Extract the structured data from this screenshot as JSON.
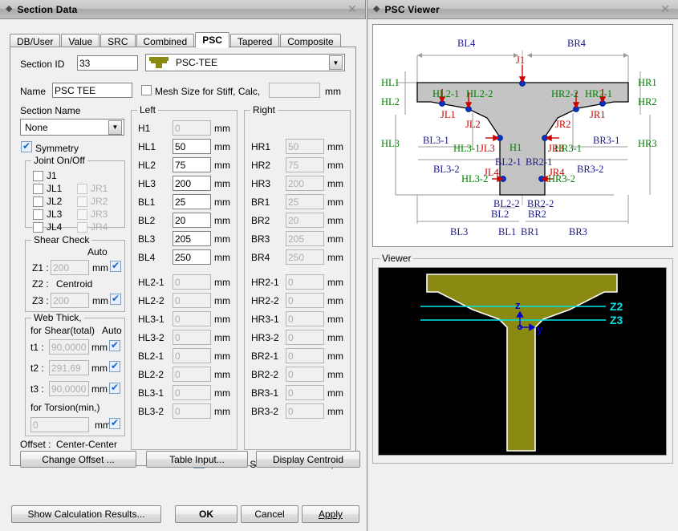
{
  "section_window": {
    "title": "Section Data",
    "close_label": "✕",
    "tabs": [
      {
        "label": "DB/User",
        "active": false
      },
      {
        "label": "Value",
        "active": false
      },
      {
        "label": "SRC",
        "active": false
      },
      {
        "label": "Combined",
        "active": false
      },
      {
        "label": "PSC",
        "active": true
      },
      {
        "label": "Tapered",
        "active": false
      },
      {
        "label": "Composite",
        "active": false
      }
    ],
    "section_id": {
      "label": "Section ID",
      "value": "33"
    },
    "section_type": {
      "value": "PSC-TEE",
      "icon": "psc-tee-icon"
    },
    "name": {
      "label": "Name",
      "value": "PSC TEE"
    },
    "mesh_size": {
      "label": "Mesh Size for Stiff, Calc,",
      "checked": false,
      "value": "",
      "unit": "mm"
    },
    "section_name": {
      "label": "Section Name",
      "value": "None"
    },
    "symmetry": {
      "label": "Symmetry",
      "checked": true
    },
    "joint_onoff": {
      "caption": "Joint On/Off",
      "items": [
        {
          "label": "J1",
          "checked": false,
          "disabled": false
        },
        {
          "label": "JL1",
          "checked": false,
          "disabled": false
        },
        {
          "label": "JL2",
          "checked": false,
          "disabled": false
        },
        {
          "label": "JL3",
          "checked": false,
          "disabled": false
        },
        {
          "label": "JL4",
          "checked": false,
          "disabled": false
        }
      ],
      "items_right": [
        {
          "label": "JR1",
          "checked": false,
          "disabled": true
        },
        {
          "label": "JR2",
          "checked": false,
          "disabled": true
        },
        {
          "label": "JR3",
          "checked": false,
          "disabled": true
        },
        {
          "label": "JR4",
          "checked": false,
          "disabled": true
        }
      ]
    },
    "shear_check": {
      "caption": "Shear Check",
      "auto_label": "Auto",
      "z1": {
        "label": "Z1 :",
        "value": "200",
        "unit": "mm",
        "auto": true,
        "disabled": true
      },
      "z2": {
        "label": "Z2 :",
        "text": "Centroid"
      },
      "z3": {
        "label": "Z3 :",
        "value": "200",
        "unit": "mm",
        "auto": true,
        "disabled": true
      }
    },
    "web_thick": {
      "caption": "Web Thick,",
      "subtitle": "for Shear(total)",
      "auto_label": "Auto",
      "t1": {
        "label": "t1 :",
        "value": "90,0000",
        "unit": "mm",
        "auto": true,
        "disabled": true
      },
      "t2": {
        "label": "t2 :",
        "value": "291,69",
        "unit": "mm",
        "auto": true,
        "disabled": true
      },
      "t3": {
        "label": "t3 :",
        "value": "90,0000",
        "unit": "mm",
        "auto": true,
        "disabled": true
      },
      "torsion_label": "for Torsion(min,)",
      "torsion": {
        "value": "0",
        "unit": "mm",
        "auto": true,
        "disabled": true
      }
    },
    "left_group": {
      "caption": "Left",
      "unit": "mm",
      "fields": [
        {
          "label": "H1",
          "value": "0",
          "disabled": true
        },
        {
          "label": "HL1",
          "value": "50",
          "disabled": false
        },
        {
          "label": "HL2",
          "value": "75",
          "disabled": false
        },
        {
          "label": "HL3",
          "value": "200",
          "disabled": false
        },
        {
          "label": "BL1",
          "value": "25",
          "disabled": false
        },
        {
          "label": "BL2",
          "value": "20",
          "disabled": false
        },
        {
          "label": "BL3",
          "value": "205",
          "disabled": false
        },
        {
          "label": "BL4",
          "value": "250",
          "disabled": false
        },
        {
          "label": "HL2-1",
          "value": "0",
          "disabled": true
        },
        {
          "label": "HL2-2",
          "value": "0",
          "disabled": true
        },
        {
          "label": "HL3-1",
          "value": "0",
          "disabled": true
        },
        {
          "label": "HL3-2",
          "value": "0",
          "disabled": true
        },
        {
          "label": "BL2-1",
          "value": "0",
          "disabled": true
        },
        {
          "label": "BL2-2",
          "value": "0",
          "disabled": true
        },
        {
          "label": "BL3-1",
          "value": "0",
          "disabled": true
        },
        {
          "label": "BL3-2",
          "value": "0",
          "disabled": true
        }
      ]
    },
    "right_group": {
      "caption": "Right",
      "unit": "mm",
      "fields": [
        {
          "label": "",
          "value": "",
          "disabled": true,
          "hidden": true
        },
        {
          "label": "HR1",
          "value": "50",
          "disabled": true
        },
        {
          "label": "HR2",
          "value": "75",
          "disabled": true
        },
        {
          "label": "HR3",
          "value": "200",
          "disabled": true
        },
        {
          "label": "BR1",
          "value": "25",
          "disabled": true
        },
        {
          "label": "BR2",
          "value": "20",
          "disabled": true
        },
        {
          "label": "BR3",
          "value": "205",
          "disabled": true
        },
        {
          "label": "BR4",
          "value": "250",
          "disabled": true
        },
        {
          "label": "HR2-1",
          "value": "0",
          "disabled": true
        },
        {
          "label": "HR2-2",
          "value": "0",
          "disabled": true
        },
        {
          "label": "HR3-1",
          "value": "0",
          "disabled": true
        },
        {
          "label": "HR3-2",
          "value": "0",
          "disabled": true
        },
        {
          "label": "BR2-1",
          "value": "0",
          "disabled": true
        },
        {
          "label": "BR2-2",
          "value": "0",
          "disabled": true
        },
        {
          "label": "BR3-1",
          "value": "0",
          "disabled": true
        },
        {
          "label": "BR3-2",
          "value": "0",
          "disabled": true
        }
      ]
    },
    "consider_shear": {
      "label": "Consider Shear Deformation,",
      "checked": true
    },
    "offset": {
      "label": "Offset :",
      "value": "Center-Center"
    },
    "buttons": {
      "change_offset": "Change Offset ...",
      "table_input": "Table Input...",
      "display_centroid": "Display Centroid",
      "show_calc": "Show Calculation Results...",
      "ok": "OK",
      "cancel": "Cancel",
      "apply": "Apply"
    }
  },
  "viewer_window": {
    "title": "PSC Viewer",
    "close_label": "✕",
    "viewer_caption": "Viewer",
    "colors": {
      "dim_blue": "#1a1a8c",
      "green": "#008000",
      "red": "#cc0000",
      "section_fill": "#c0c0c0",
      "joint_dot": "#0033cc",
      "viewer_fill": "#8a8a12",
      "viewer_bg": "#000000",
      "axis_cyan": "#00e5e5",
      "axis_blue": "#0000cc"
    },
    "diagram_labels": {
      "blue": [
        "BL4",
        "BR4",
        "BL3-1",
        "BL3-2",
        "BR3-1",
        "BR3-2",
        "BL2-1",
        "BR2-1",
        "BL2-2",
        "BR2-2",
        "BL2",
        "BR2",
        "BL3",
        "BL1",
        "BR1",
        "BR3"
      ],
      "green": [
        "HL1",
        "HL2",
        "HL3",
        "HR1",
        "HR2",
        "HR3",
        "HL2-1",
        "HL2-2",
        "HR2-2",
        "HR2-1",
        "HL3-1",
        "HL3-2",
        "HR3-1",
        "HR3-2",
        "H1"
      ],
      "red": [
        "J1",
        "JL1",
        "JL2",
        "JL3",
        "JL4",
        "JR1",
        "JR2",
        "JR3",
        "JR4"
      ]
    },
    "axis_labels": {
      "z": "z",
      "y": "y",
      "z2": "Z2",
      "z3": "Z3"
    }
  }
}
